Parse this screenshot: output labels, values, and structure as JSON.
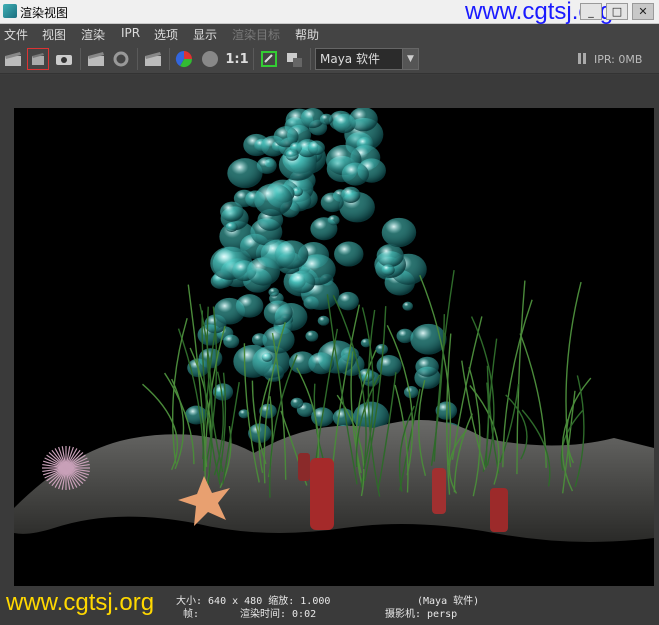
{
  "window": {
    "title": "渲染视图",
    "watermark_top": "www.cgtsj.org",
    "controls": [
      "_",
      "□",
      "✕"
    ]
  },
  "menu": [
    "文件",
    "视图",
    "渲染",
    "IPR",
    "选项",
    "显示",
    "渲染目标",
    "帮助"
  ],
  "toolbar": {
    "ratio_label": "1:1",
    "renderer": "Maya 软件",
    "ipr_label": "IPR: 0MB"
  },
  "status": {
    "size_line": "大小: 640 x 480 缩放: 1.000",
    "renderer_line": "(Maya 软件)",
    "frame_label": "帧:",
    "render_time": "渲染时间: 0:02",
    "camera": "摄影机: persp"
  },
  "watermark_bottom": "www.cgtsj.org",
  "colors": {
    "accent": "#1a1aff",
    "watermark": "#ffd800",
    "bubble": "#3fc7c2"
  }
}
